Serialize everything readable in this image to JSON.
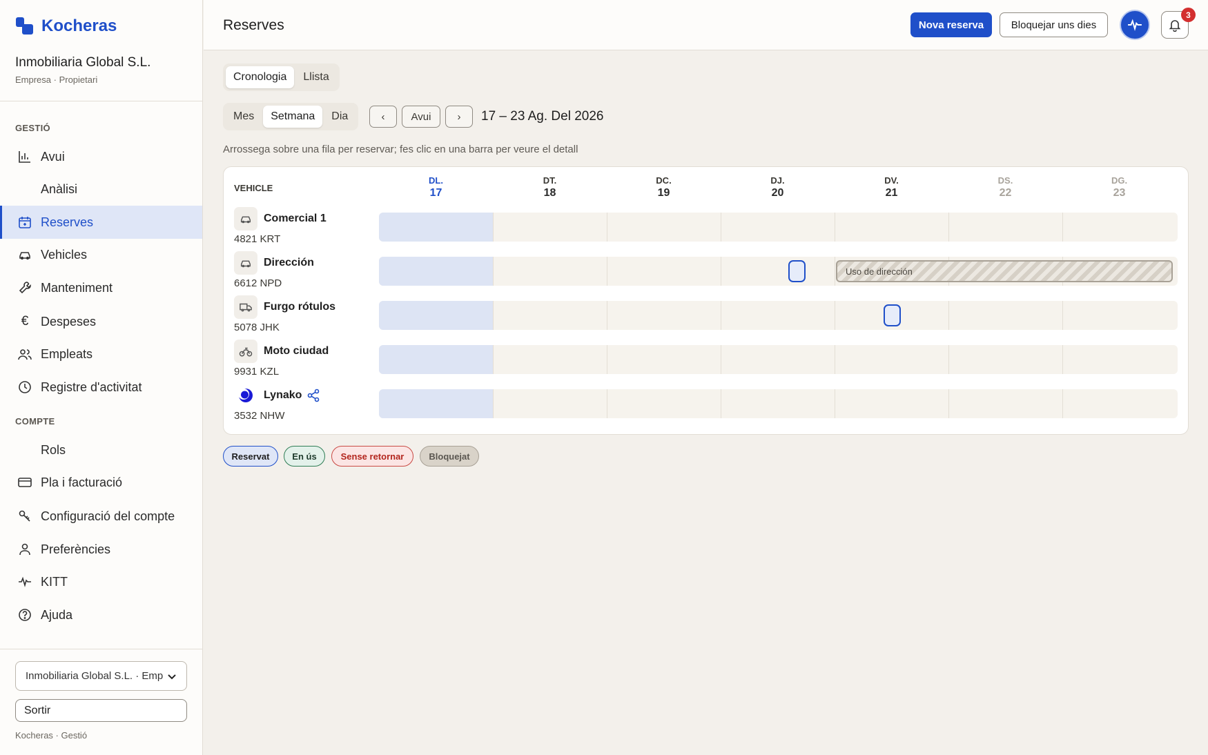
{
  "brand": {
    "name": "Kocheras"
  },
  "org": {
    "name": "Inmobiliaria Global S.L.",
    "role": "Empresa · Propietari"
  },
  "sidebar": {
    "section_manage": "GESTIÓ",
    "section_account": "COMPTE",
    "items": [
      {
        "label": "Avui",
        "icon": "bar-chart-icon"
      },
      {
        "label": "Anàlisi",
        "icon": ""
      },
      {
        "label": "Reserves",
        "icon": "calendar-icon",
        "active": true
      },
      {
        "label": "Vehicles",
        "icon": "car-icon"
      },
      {
        "label": "Manteniment",
        "icon": "wrench-icon"
      },
      {
        "label": "Despeses",
        "icon": "euro-icon"
      },
      {
        "label": "Empleats",
        "icon": "users-icon"
      },
      {
        "label": "Registre d'activitat",
        "icon": "clock-icon"
      }
    ],
    "account_items": [
      {
        "label": "Rols",
        "icon": ""
      },
      {
        "label": "Pla i facturació",
        "icon": "credit-card-icon"
      },
      {
        "label": "Configuració del compte",
        "icon": "key-icon"
      },
      {
        "label": "Preferències",
        "icon": "user-icon"
      },
      {
        "label": "KITT",
        "icon": "pulse-icon"
      },
      {
        "label": "Ajuda",
        "icon": "help-icon"
      }
    ],
    "org_select_value": "Inmobiliaria Global S.L. · Empresa",
    "logout_label": "Sortir",
    "footer": "Kocheras · Gestió"
  },
  "header": {
    "title": "Reserves",
    "new_booking": "Nova reserva",
    "block_days": "Bloquejar uns dies",
    "notifications_count": "3"
  },
  "view_tabs": {
    "timeline": "Cronologia",
    "list": "Llista"
  },
  "range_tabs": {
    "month": "Mes",
    "week": "Setmana",
    "day": "Dia"
  },
  "nav": {
    "prev": "‹",
    "today": "Avui",
    "next": "›",
    "range_label": "17 – 23 Ag. Del 2026"
  },
  "hint": "Arrossega sobre una fila per reservar; fes clic en una barra per veure el detall",
  "timeline": {
    "vehicle_header": "VEHICLE",
    "days": [
      {
        "name": "DL.",
        "num": "17",
        "today": true
      },
      {
        "name": "DT.",
        "num": "18"
      },
      {
        "name": "DC.",
        "num": "19"
      },
      {
        "name": "DJ.",
        "num": "20"
      },
      {
        "name": "DV.",
        "num": "21"
      },
      {
        "name": "DS.",
        "num": "22",
        "weekend": true
      },
      {
        "name": "DG.",
        "num": "23",
        "weekend": true
      }
    ],
    "vehicles": [
      {
        "name": "Comercial 1",
        "plate": "4821 KRT",
        "icon": "car-icon"
      },
      {
        "name": "Dirección",
        "plate": "6612 NPD",
        "icon": "car-icon"
      },
      {
        "name": "Furgo rótulos",
        "plate": "5078 JHK",
        "icon": "van-icon"
      },
      {
        "name": "Moto ciudad",
        "plate": "9931 KZL",
        "icon": "motorbike-icon"
      },
      {
        "name": "Lynako",
        "plate": "3532 NHW",
        "icon": "lynako-logo-icon"
      }
    ],
    "blocked_label": "Uso de dirección"
  },
  "legend": {
    "reserved": "Reservat",
    "in_use": "En ús",
    "not_returned": "Sense retornar",
    "blocked": "Bloquejat"
  },
  "colors": {
    "accent": "#1f4fc9",
    "reserved": "#dfe6f7",
    "in_use": "#e3f1ea",
    "not_returned": "#fbe5e4",
    "blocked": "#d9d3c9"
  }
}
